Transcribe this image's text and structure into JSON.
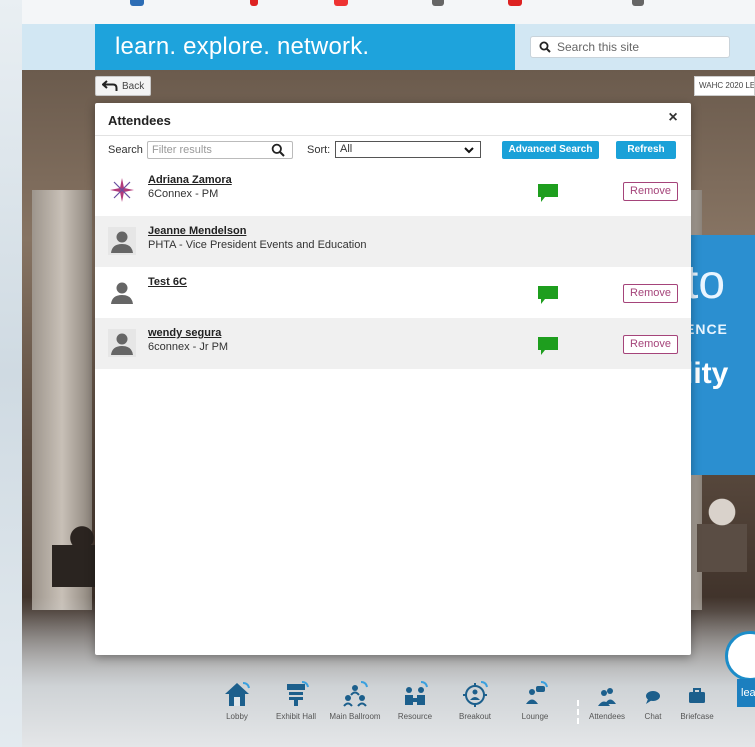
{
  "site": {
    "tagline": "learn. explore. network.",
    "search_placeholder": "Search this site",
    "back_label": "Back",
    "event_tag": "WAHC 2020 LE"
  },
  "colors": {
    "brand_blue": "#1ea3dc",
    "chat_green": "#1e9e1e",
    "remove_purple": "#a5447a"
  },
  "modal": {
    "title": "Attendees",
    "close_glyph": "×",
    "search_label": "Search",
    "search_placeholder": "Filter results",
    "sort_label": "Sort:",
    "sort_value": "All",
    "advanced_search_label": "Advanced Search",
    "refresh_label": "Refresh"
  },
  "attendees": [
    {
      "name": "Adriana Zamora",
      "subtitle": "6Connex - PM",
      "avatar": "star-logo-icon",
      "chat": true,
      "remove": "Remove"
    },
    {
      "name": "Jeanne Mendelson",
      "subtitle": "PHTA - Vice President Events and Education",
      "avatar": "person-icon",
      "chat": false,
      "remove": ""
    },
    {
      "name": "Test 6C",
      "subtitle": "",
      "avatar": "person-icon",
      "chat": true,
      "remove": "Remove"
    },
    {
      "name": "wendy segura",
      "subtitle": "6connex - Jr PM",
      "avatar": "person-icon",
      "chat": true,
      "remove": "Remove"
    }
  ],
  "nav": [
    {
      "label": "Lobby",
      "icon": "house-icon"
    },
    {
      "label": "Exhibit Hall",
      "icon": "booth-icon"
    },
    {
      "label": "Main Ballroom",
      "icon": "people-group-icon"
    },
    {
      "label": "Resource",
      "icon": "resource-icon"
    },
    {
      "label": "Breakout",
      "icon": "breakout-icon"
    },
    {
      "label": "Lounge",
      "icon": "lounge-icon"
    },
    {
      "label": "Attendees",
      "icon": "attendees-icon"
    },
    {
      "label": "Chat",
      "icon": "chat-bubble-icon"
    },
    {
      "label": "Briefcase",
      "icon": "briefcase-icon"
    }
  ],
  "scene": {
    "screen_big": "to",
    "screen_mid": "ENCE",
    "screen_big2": "lity",
    "logo_strip": "lea"
  }
}
